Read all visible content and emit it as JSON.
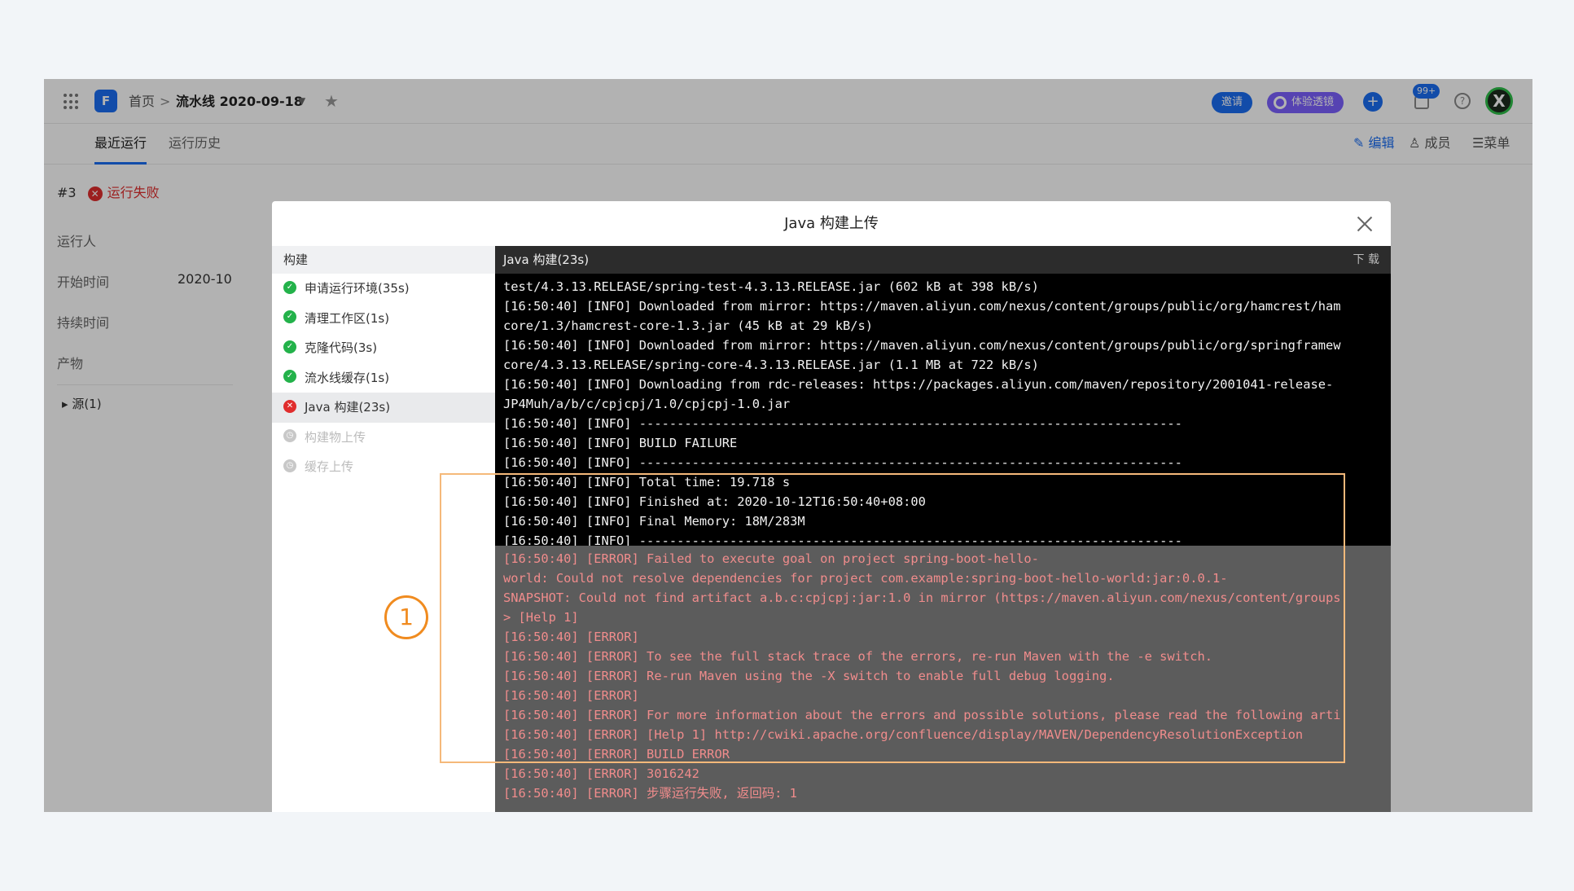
{
  "topbar": {
    "home": "首页",
    "separator": ">",
    "pipeline_name": "流水线 2020-09-18",
    "invite_label": "邀请",
    "lens_label": "体验透镜",
    "notification_count": "99+",
    "avatar_letter": "X"
  },
  "tabs": {
    "recent": "最近运行",
    "history": "运行历史",
    "edit": "编辑",
    "members": "成员",
    "menu": "菜单"
  },
  "run": {
    "number": "#3",
    "status": "运行失败",
    "runner_label": "运行人",
    "start_label": "开始时间",
    "start_value": "2020-10",
    "duration_label": "持续时间",
    "artifact_label": "产物",
    "source_label": "源(1)"
  },
  "modal": {
    "title": "Java 构建上传",
    "steps_header": "构建",
    "log_header": "Java 构建(23s)",
    "download_label": "下 载",
    "steps": [
      {
        "label": "申请运行环境(35s)",
        "status": "success"
      },
      {
        "label": "清理工作区(1s)",
        "status": "success"
      },
      {
        "label": "克隆代码(3s)",
        "status": "success"
      },
      {
        "label": "流水线缓存(1s)",
        "status": "success"
      },
      {
        "label": "Java 构建(23s)",
        "status": "failed"
      },
      {
        "label": "构建物上传",
        "status": "pending"
      },
      {
        "label": "缓存上传",
        "status": "pending"
      }
    ],
    "log_info": "test/4.3.13.RELEASE/spring-test-4.3.13.RELEASE.jar (602 kB at 398 kB/s)\n[16:50:40] [INFO] Downloaded from mirror: https://maven.aliyun.com/nexus/content/groups/public/org/hamcrest/ham\ncore/1.3/hamcrest-core-1.3.jar (45 kB at 29 kB/s)\n[16:50:40] [INFO] Downloaded from mirror: https://maven.aliyun.com/nexus/content/groups/public/org/springframew\ncore/4.3.13.RELEASE/spring-core-4.3.13.RELEASE.jar (1.1 MB at 722 kB/s)\n[16:50:40] [INFO] Downloading from rdc-releases: https://packages.aliyun.com/maven/repository/2001041-release-\nJP4Muh/a/b/c/cpjcpj/1.0/cpjcpj-1.0.jar\n[16:50:40] [INFO] ------------------------------------------------------------------------\n[16:50:40] [INFO] BUILD FAILURE\n[16:50:40] [INFO] ------------------------------------------------------------------------\n[16:50:40] [INFO] Total time: 19.718 s\n[16:50:40] [INFO] Finished at: 2020-10-12T16:50:40+08:00\n[16:50:40] [INFO] Final Memory: 18M/283M\n[16:50:40] [INFO] ------------------------------------------------------------------------",
    "log_errors": "[16:50:40] [ERROR] Failed to execute goal on project spring-boot-hello-\nworld: Could not resolve dependencies for project com.example:spring-boot-hello-world:jar:0.0.1-\nSNAPSHOT: Could not find artifact a.b.c:cpjcpj:jar:1.0 in mirror (https://maven.aliyun.com/nexus/content/groups\n> [Help 1]\n[16:50:40] [ERROR]\n[16:50:40] [ERROR] To see the full stack trace of the errors, re-run Maven with the -e switch.\n[16:50:40] [ERROR] Re-run Maven using the -X switch to enable full debug logging.\n[16:50:40] [ERROR]\n[16:50:40] [ERROR] For more information about the errors and possible solutions, please read the following arti\n[16:50:40] [ERROR] [Help 1] http://cwiki.apache.org/confluence/display/MAVEN/DependencyResolutionException\n[16:50:40] [ERROR] BUILD ERROR\n[16:50:40] [ERROR] 3016242\n[16:50:40] [ERROR] 步骤运行失败, 返回码: 1"
  },
  "callout_number": "1",
  "colors": {
    "accent": "#1b6ef3",
    "success": "#23b24a",
    "error": "#e02d2d",
    "error_text": "#f08c8c",
    "callout": "#f08b1f"
  }
}
